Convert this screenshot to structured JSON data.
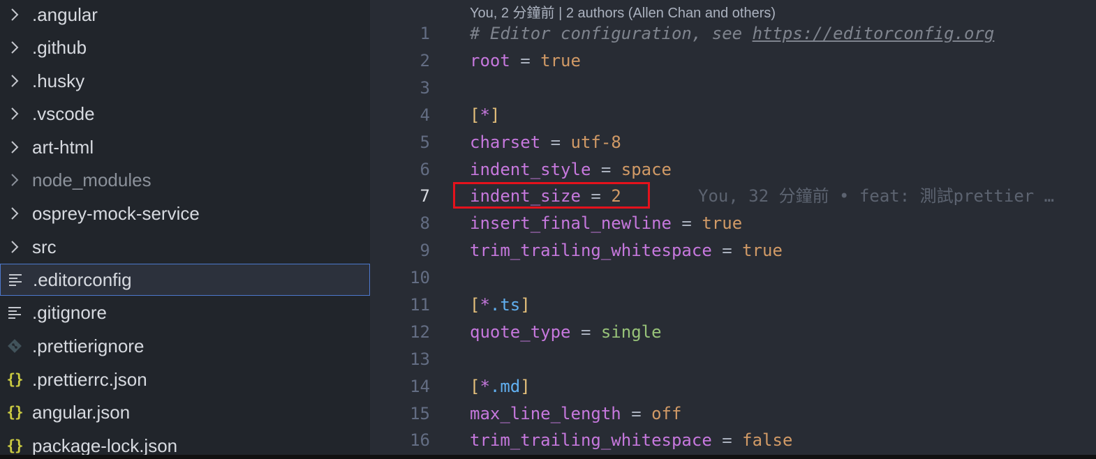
{
  "sidebar": {
    "items": [
      {
        "label": ".angular",
        "icon": "chevron-right-icon"
      },
      {
        "label": ".github",
        "icon": "chevron-right-icon"
      },
      {
        "label": ".husky",
        "icon": "chevron-right-icon"
      },
      {
        "label": ".vscode",
        "icon": "chevron-right-icon"
      },
      {
        "label": "art-html",
        "icon": "chevron-right-icon"
      },
      {
        "label": "node_modules",
        "icon": "chevron-right-icon"
      },
      {
        "label": "osprey-mock-service",
        "icon": "chevron-right-icon"
      },
      {
        "label": "src",
        "icon": "chevron-right-icon"
      },
      {
        "label": ".editorconfig",
        "icon": "text-file-icon"
      },
      {
        "label": ".gitignore",
        "icon": "text-file-icon"
      },
      {
        "label": ".prettierignore",
        "icon": "git-icon"
      },
      {
        "label": ".prettierrc.json",
        "icon": "json-icon"
      },
      {
        "label": "angular.json",
        "icon": "json-icon"
      },
      {
        "label": "package-lock.json",
        "icon": "json-icon"
      }
    ],
    "selected": ".editorconfig",
    "json_glyph": "{}"
  },
  "editor": {
    "blame_header": "You, 2 分鐘前 | 2 authors (Allen Chan and others)",
    "inline_blame": "You, 32 分鐘前 • feat: 測試prettier …",
    "active_line": 7,
    "lines": [
      {
        "n": "1",
        "comment": "# Editor configuration, see ",
        "url": "https://editorconfig.org"
      },
      {
        "n": "2",
        "key": "root",
        "eq": " = ",
        "val": "true"
      },
      {
        "n": "3"
      },
      {
        "n": "4",
        "open": "[",
        "star": "*",
        "close": "]"
      },
      {
        "n": "5",
        "key": "charset",
        "eq": " = ",
        "val": "utf-8"
      },
      {
        "n": "6",
        "key": "indent_style",
        "eq": " = ",
        "val": "space"
      },
      {
        "n": "7",
        "key": "indent_size",
        "eq": " = ",
        "val": "2"
      },
      {
        "n": "8",
        "key": "insert_final_newline",
        "eq": " = ",
        "val": "true"
      },
      {
        "n": "9",
        "key": "trim_trailing_whitespace",
        "eq": " = ",
        "val": "true"
      },
      {
        "n": "10"
      },
      {
        "n": "11",
        "open": "[",
        "star": "*",
        "ext": ".ts",
        "close": "]"
      },
      {
        "n": "12",
        "key": "quote_type",
        "eq": " = ",
        "str": "single"
      },
      {
        "n": "13"
      },
      {
        "n": "14",
        "open": "[",
        "star": "*",
        "ext": ".md",
        "close": "]"
      },
      {
        "n": "15",
        "key": "max_line_length",
        "eq": " = ",
        "val": "off"
      },
      {
        "n": "16",
        "key": "trim_trailing_whitespace",
        "eq": " = ",
        "val": "false"
      }
    ]
  },
  "colors": {
    "selection_border": "#4d78cc",
    "highlight_box": "#e4121c",
    "keyword": "#c678dd",
    "value": "#d19a66",
    "string": "#98c379",
    "bracket": "#e5c07b",
    "extension": "#61afef"
  }
}
